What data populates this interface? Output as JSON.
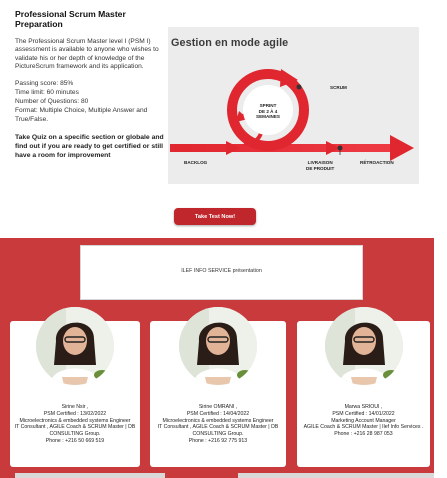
{
  "intro": {
    "title": "Professional Scrum Master Preparation",
    "description": "The Professional Scrum Master level I (PSM I) assessment is available to anyone who wishes to validate his or her depth of knowledge of the PictureScrum framework and its application.",
    "passing_score": "Passing score: 85%",
    "time_limit": "Time limit: 60 minutes",
    "questions": "Number of Questions: 80",
    "format": "Format: Multiple Choice, Multiple Answer and True/False.",
    "cta_text": "Take Quiz on a specific section or globale and find out if you are ready to get certified or still have a room for improvement"
  },
  "hero": {
    "title": "Gestion en mode agile",
    "scrum": "SCRUM",
    "sprint_l1": "SPRINT",
    "sprint_l2": "DE 2 À 4",
    "sprint_l3": "SEMAINES",
    "backlog": "BACKLOG",
    "livraison_l1": "LIVRAISON",
    "livraison_l2": "DE PRODUIT",
    "retroaction": "RÉTROACTION",
    "accent_color": "#e0262f"
  },
  "cta_button": "Take Test Now!",
  "video_caption": "ILEF INFO SERVICE présentation",
  "team": [
    {
      "name": "Sirine Nsir ,",
      "cert": "PSM Certified : 13/02/2022",
      "role": "Microelectronics & embedded systems Engineer",
      "position": "IT Consultant , AGILE Coach & SCRUM Master | DB CONSULTING Group.",
      "phone": "Phone : +216 50 669 519"
    },
    {
      "name": "Sirine OMRANI ,",
      "cert": "PSM Certified : 14/04/2022",
      "role": "Microelectronics & embedded systems Engineer",
      "position": "IT Consultant , AGILE Coach & SCRUM Master | DB CONSULTING Group.",
      "phone": "Phone : +216 92 775 913"
    },
    {
      "name": "Marwa SRIOUI ,",
      "cert": "PSM Certified : 14/01/2022",
      "role": "Marketing Account Manager",
      "position": "AGILE Coach & SCRUM Master | Ilef Info Services .",
      "phone": "Phone : +216 28 987 053"
    }
  ],
  "colors": {
    "brand_red": "#c93a3c",
    "button_red": "#c0272d"
  }
}
